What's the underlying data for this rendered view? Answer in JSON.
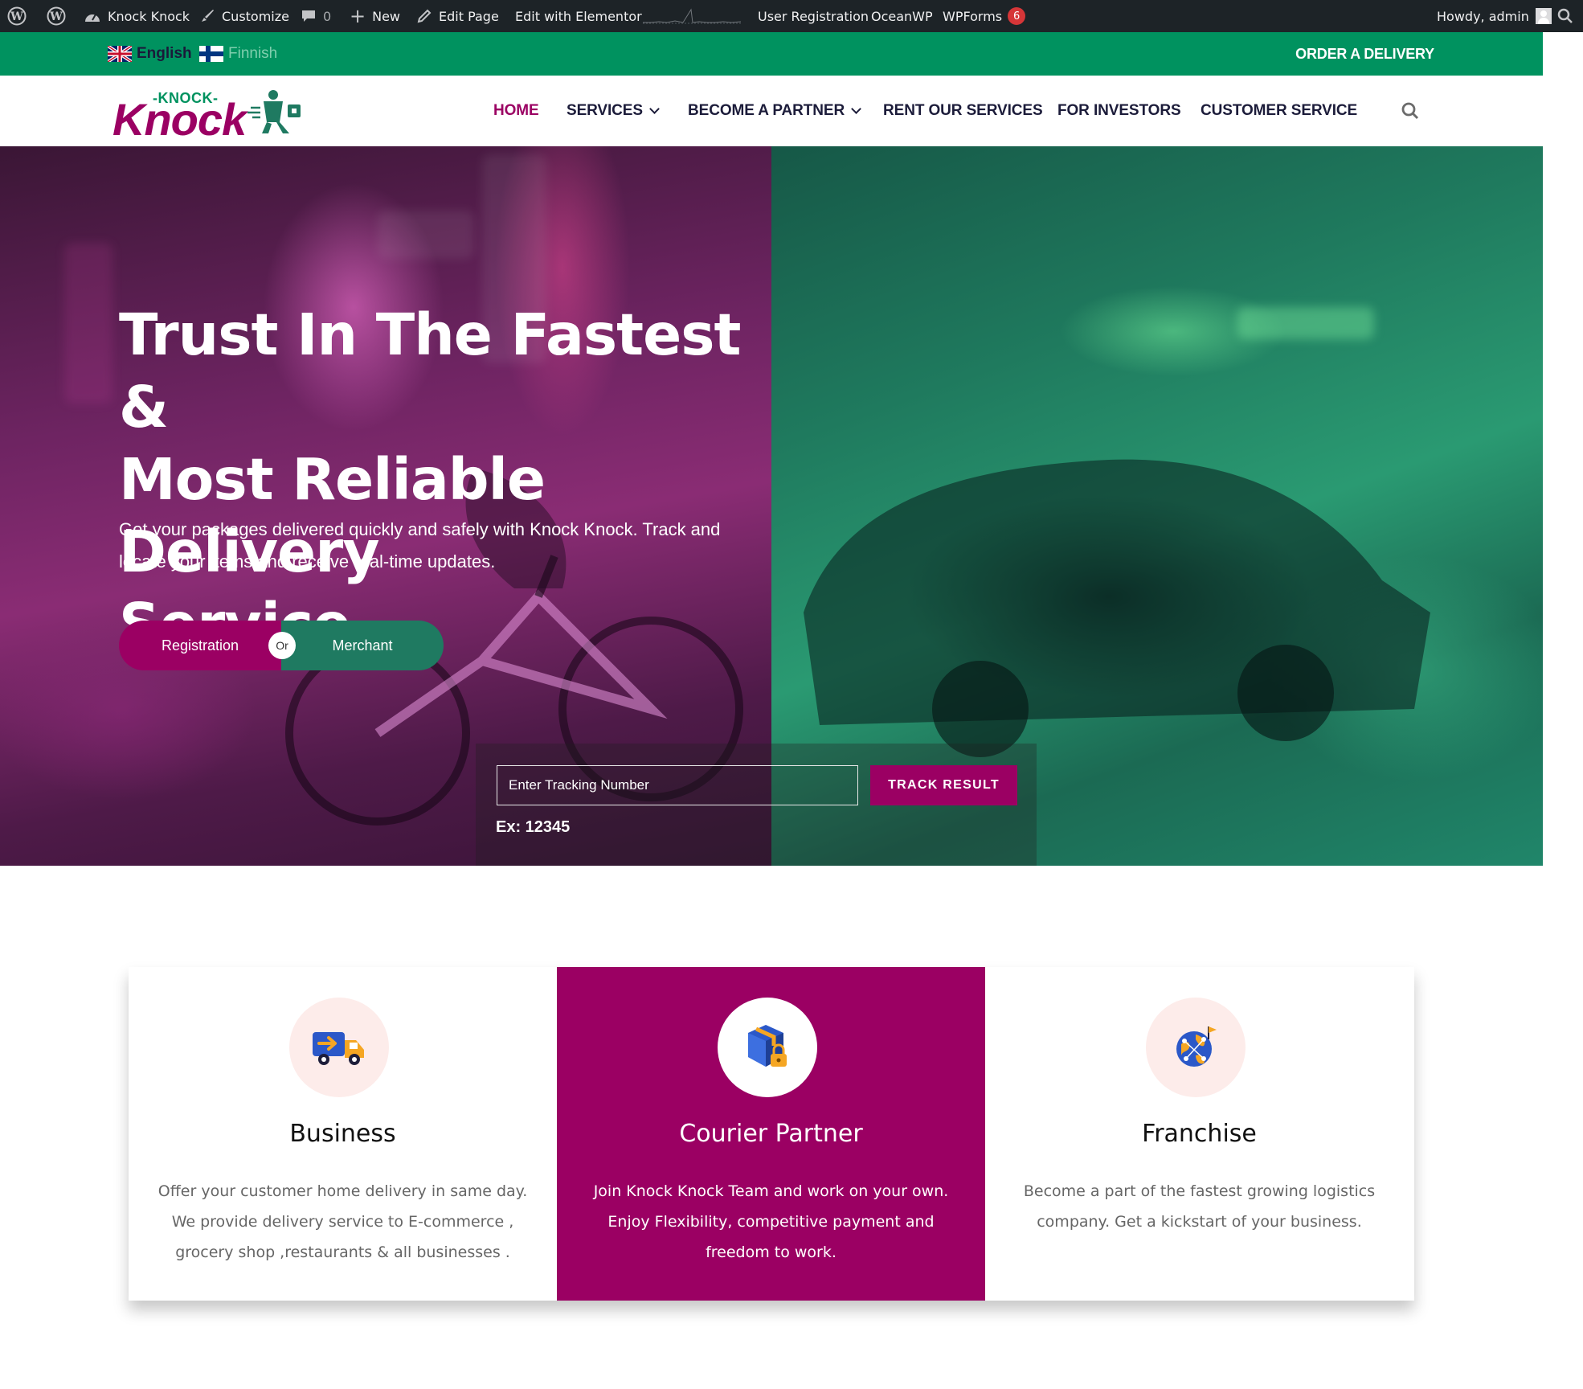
{
  "admin_bar": {
    "site_name": "Knock Knock",
    "customize": "Customize",
    "comments_count": "0",
    "new": "New",
    "edit_page": "Edit Page",
    "edit_elementor": "Edit with Elementor",
    "user_registration": "User Registration",
    "oceanwp": "OceanWP",
    "wpforms": "WPForms",
    "wpforms_badge": "6",
    "howdy": "Howdy, admin"
  },
  "topbar": {
    "lang_english": "English",
    "lang_finnish": "Finnish",
    "order_link": "ORDER A DELIVERY",
    "bg_color": "#00925f"
  },
  "logo": {
    "top_text": "-KNOCK-",
    "main_text": "Knock"
  },
  "nav": {
    "home": "HOME",
    "services": "SERVICES",
    "become_partner": "BECOME A PARTNER",
    "rent": "RENT OUR SERVICES",
    "investors": "FOR INVESTORS",
    "customer_service": "CUSTOMER SERVICE",
    "active_color": "#9b0063"
  },
  "hero": {
    "title_line1": "Trust In The Fastest &",
    "title_line2": "Most Reliable Delivery",
    "title_line3": "Service",
    "subtitle_line1": "Get your packages delivered quickly and safely with Knock Knock. Track and",
    "subtitle_line2": "locate your items and receive real-time updates.",
    "registration": "Registration",
    "or": "Or",
    "merchant": "Merchant",
    "track_placeholder": "Enter Tracking Number",
    "track_button": "TRACK RESULT",
    "track_example": "Ex: 12345"
  },
  "cards": [
    {
      "title": "Business",
      "line1": "Offer your customer home delivery in same day.",
      "line2": "We provide delivery service to E-commerce ,",
      "line3": "grocery shop ,restaurants & all businesses .",
      "icon": "delivery-truck-icon"
    },
    {
      "title": "Courier Partner",
      "line1": "Join Knock Knock Team and work on your own.",
      "line2": "Enjoy Flexibility, competitive payment and",
      "line3": "freedom to work.",
      "icon": "locked-package-icon"
    },
    {
      "title": "Franchise",
      "line1": "Become a part of the fastest growing logistics",
      "line2": "company. Get a kickstart of your business.",
      "icon": "globe-network-icon"
    }
  ],
  "colors": {
    "brand_magenta": "#9b0063",
    "brand_green": "#00925f",
    "merchant_green": "#1f7a61"
  }
}
